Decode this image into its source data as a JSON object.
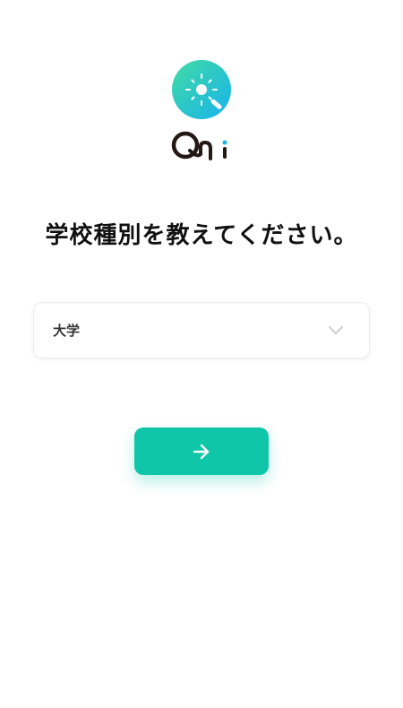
{
  "brand": {
    "logo_icon": "qni-logo-mark",
    "logo_text_icon": "qni-wordmark",
    "accent_color": "#0fc6a8",
    "logo_gradient": [
      "#3ad8a6",
      "#1ab7e8"
    ]
  },
  "question": {
    "title": "学校種別を教えてください。"
  },
  "school_type_select": {
    "selected_value": "大学",
    "icon": "chevron-down-icon"
  },
  "next_button": {
    "icon": "arrow-right-icon"
  }
}
